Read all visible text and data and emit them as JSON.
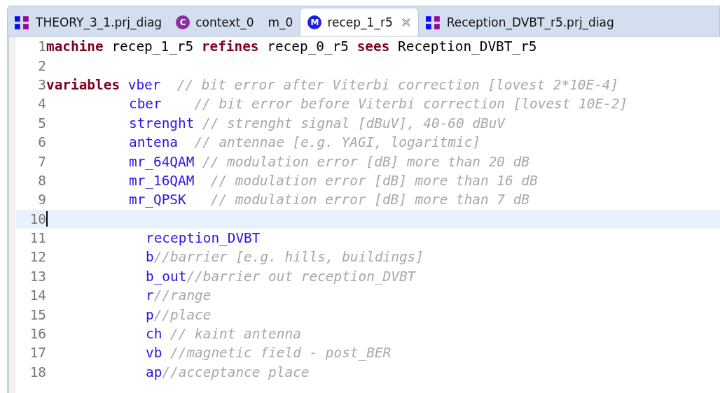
{
  "tabs": [
    {
      "label": "THEORY_3_1.prj_diag",
      "kind": "diagram",
      "selected": false
    },
    {
      "label": "context_0",
      "kind": "context",
      "icon_text": "C",
      "selected": false
    },
    {
      "label": "m_0",
      "kind": "plain",
      "selected": false
    },
    {
      "label": "recep_1_r5",
      "kind": "machine",
      "icon_text": "M",
      "selected": true
    },
    {
      "label": "Reception_DVBT_r5.prj_diag",
      "kind": "diagram",
      "selected": false
    }
  ],
  "editor": {
    "lines": [
      {
        "number": "1",
        "kind": "header",
        "current": false,
        "tokens": [
          {
            "kind": "keyword",
            "text": "machine"
          },
          {
            "kind": "plain",
            "text": "recep_1_r5"
          },
          {
            "kind": "keyword",
            "text": "refines"
          },
          {
            "kind": "plain",
            "text": "recep_0_r5"
          },
          {
            "kind": "keyword",
            "text": "sees"
          },
          {
            "kind": "plain",
            "text": "Reception_DVBT_r5"
          }
        ]
      },
      {
        "number": "2",
        "kind": "header",
        "current": false
      },
      {
        "number": "3",
        "kind": "header",
        "current": false,
        "tokens": [
          {
            "kind": "keyword",
            "text": "variables"
          },
          {
            "kind": "identifier",
            "text": "vber"
          },
          {
            "kind": "comment",
            "text": "  // bit error after Viterbi correction [lovest 2*10E-4]"
          }
        ]
      },
      {
        "number": "4",
        "kind": "variable",
        "current": false,
        "tokens": [
          {
            "kind": "identifier",
            "text": "cber"
          },
          {
            "kind": "comment",
            "text": "    // bit error before Viterbi correction [lovest 10E-2]"
          }
        ]
      },
      {
        "number": "5",
        "kind": "variable",
        "current": false,
        "tokens": [
          {
            "kind": "identifier",
            "text": "strenght"
          },
          {
            "kind": "comment",
            "text": " // strenght signal [dBuV], 40-60 dBuV"
          }
        ]
      },
      {
        "number": "6",
        "kind": "variable",
        "current": false,
        "tokens": [
          {
            "kind": "identifier",
            "text": "antena"
          },
          {
            "kind": "comment",
            "text": "  // antennae [e.g. YAGI, logaritmic]"
          }
        ]
      },
      {
        "number": "7",
        "kind": "variable",
        "current": false,
        "tokens": [
          {
            "kind": "identifier",
            "text": "mr_64QAM"
          },
          {
            "kind": "comment",
            "text": " // modulation error [dB] more than 20 dB"
          }
        ]
      },
      {
        "number": "8",
        "kind": "variable",
        "current": false,
        "tokens": [
          {
            "kind": "identifier",
            "text": "mr_16QAM"
          },
          {
            "kind": "comment",
            "text": "  // modulation error [dB] more than 16 dB"
          }
        ]
      },
      {
        "number": "9",
        "kind": "variable",
        "current": false,
        "tokens": [
          {
            "kind": "identifier",
            "text": "mr_QPSK"
          },
          {
            "kind": "comment",
            "text": "   // modulation error [dB] more than 7 dB"
          }
        ]
      },
      {
        "number": "10",
        "kind": "header",
        "current": true
      },
      {
        "number": "11",
        "kind": "nested",
        "current": false,
        "tokens": [
          {
            "kind": "identifier",
            "text": "reception_DVBT"
          }
        ]
      },
      {
        "number": "12",
        "kind": "nested",
        "current": false,
        "tokens": [
          {
            "kind": "identifier",
            "text": "b"
          },
          {
            "kind": "comment",
            "text": "//barrier [e.g. hills, buildings]"
          }
        ]
      },
      {
        "number": "13",
        "kind": "nested",
        "current": false,
        "tokens": [
          {
            "kind": "identifier",
            "text": "b_out"
          },
          {
            "kind": "comment",
            "text": "//barrier out reception_DVBT"
          }
        ]
      },
      {
        "number": "14",
        "kind": "nested",
        "current": false,
        "tokens": [
          {
            "kind": "identifier",
            "text": "r"
          },
          {
            "kind": "comment",
            "text": "//range"
          }
        ]
      },
      {
        "number": "15",
        "kind": "nested",
        "current": false,
        "tokens": [
          {
            "kind": "identifier",
            "text": "p"
          },
          {
            "kind": "comment",
            "text": "//place"
          }
        ]
      },
      {
        "number": "16",
        "kind": "nested",
        "current": false,
        "tokens": [
          {
            "kind": "identifier",
            "text": "ch"
          },
          {
            "kind": "comment",
            "text": " // kaint antenna"
          }
        ]
      },
      {
        "number": "17",
        "kind": "nested",
        "current": false,
        "tokens": [
          {
            "kind": "identifier",
            "text": "vb"
          },
          {
            "kind": "comment",
            "text": " //magnetic field - post_BER"
          }
        ]
      },
      {
        "number": "18",
        "kind": "nested",
        "current": false,
        "tokens": [
          {
            "kind": "identifier",
            "text": "ap"
          },
          {
            "kind": "comment",
            "text": "//acceptance place"
          }
        ]
      }
    ]
  }
}
